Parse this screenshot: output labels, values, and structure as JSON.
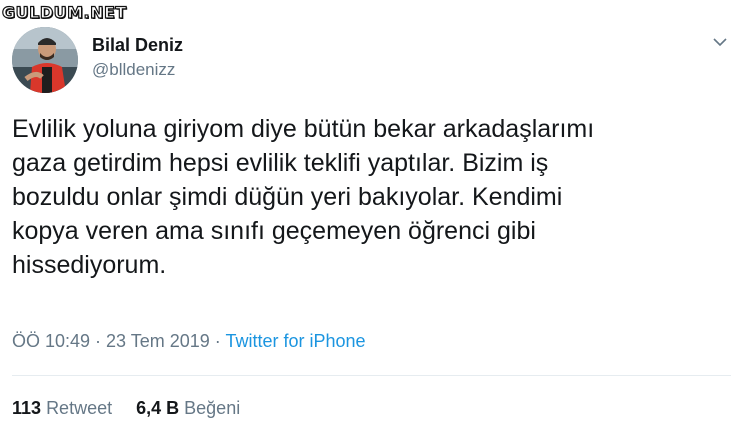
{
  "watermark": {
    "text": "GULDUM.NET"
  },
  "author": {
    "display_name": "Bilal Deniz",
    "handle": "@blldenizz"
  },
  "icons": {
    "menu": "chevron-down-icon",
    "avatar": "profile-photo"
  },
  "tweet": {
    "text": "Evlilik yoluna giriyom diye bütün bekar arkadaşlarımı\ngaza getirdim hepsi evlilik teklifi yaptılar. Bizim iş\nbozuldu onlar şimdi düğün yeri bakıyolar. Kendimi\nkopya veren ama sınıfı geçemeyen öğrenci gibi\nhissediyorum."
  },
  "meta": {
    "time": "ÖÖ 10:49",
    "sep1": " · ",
    "date": "23 Tem 2019",
    "sep2": " · ",
    "source": "Twitter for iPhone"
  },
  "stats": {
    "retweets_count": "113",
    "retweets_label": "Retweet",
    "likes_count": "6,4 B",
    "likes_label": "Beğeni"
  },
  "colors": {
    "text": "#14171a",
    "secondary": "#657786",
    "link": "#1b95e0",
    "divider": "#e6ecf0"
  }
}
